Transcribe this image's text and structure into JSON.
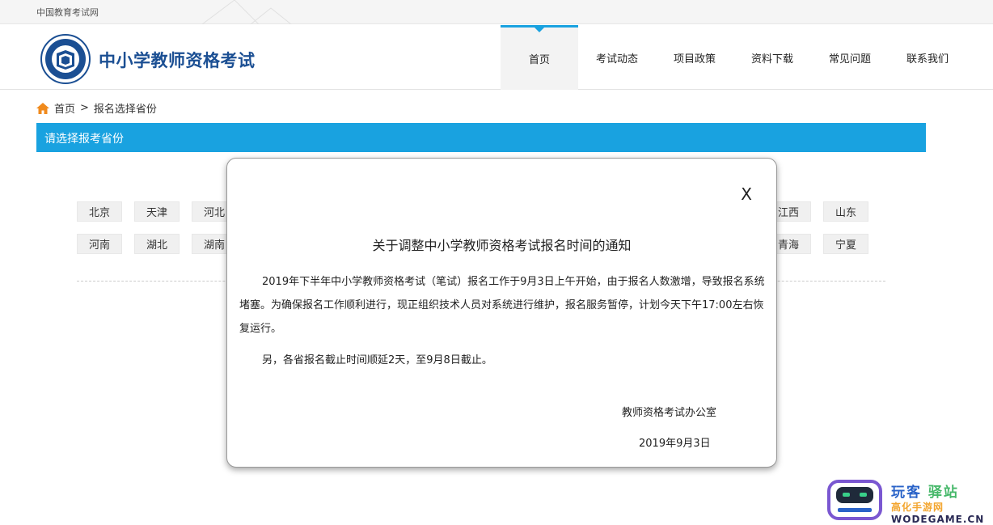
{
  "topbar": {
    "site_name": "中国教育考试网"
  },
  "header": {
    "title": "中小学教师资格考试",
    "nav": [
      {
        "label": "首页",
        "active": true
      },
      {
        "label": "考试动态"
      },
      {
        "label": "项目政策"
      },
      {
        "label": "资料下载"
      },
      {
        "label": "常见问题"
      },
      {
        "label": "联系我们"
      }
    ]
  },
  "breadcrumb": {
    "home": "首页",
    "separator": ">",
    "current": "报名选择省份"
  },
  "section_title": "请选择报考省份",
  "provinces": {
    "row1_left": [
      "北京",
      "天津",
      "河北"
    ],
    "row1_right": [
      "江西",
      "山东"
    ],
    "row2_left": [
      "河南",
      "湖北",
      "湖南"
    ],
    "row2_right": [
      "青海",
      "宁夏"
    ]
  },
  "modal": {
    "close": "X",
    "title": "关于调整中小学教师资格考试报名时间的通知",
    "para1": "2019年下半年中小学教师资格考试（笔试）报名工作于9月3日上午开始，由于报名人数激增，导致报名系统堵塞。为确保报名工作顺利进行，现正组织技术人员对系统进行维护，报名服务暂停，计划今天下午17:00左右恢复运行。",
    "para2": "另，各省报名截止时间顺延2天，至9月8日截止。",
    "signer": "教师资格考试办公室",
    "date": "2019年9月3日"
  },
  "watermark": {
    "line1a": "玩客",
    "line1b": "驿站",
    "line2a": "高化手游网",
    "line2b": "WODEGAME.CN"
  },
  "colors": {
    "accent": "#19a2e0",
    "title_blue": "#1b4f93"
  }
}
